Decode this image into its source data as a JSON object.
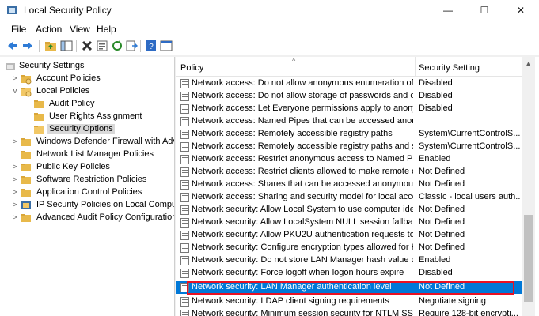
{
  "window": {
    "title": "Local Security Policy",
    "minimize_glyph": "—",
    "maximize_glyph": "☐",
    "close_glyph": "✕"
  },
  "menu": [
    "File",
    "Action",
    "View",
    "Help"
  ],
  "toolbar": {
    "icons": [
      "back-arrow-icon",
      "forward-arrow-icon",
      "up-folder-icon",
      "show-hide-tree-icon",
      "delete-icon",
      "properties-icon",
      "refresh-icon",
      "export-list-icon",
      "help-icon",
      "help-topics-icon"
    ]
  },
  "tree": [
    {
      "label": "Security Settings",
      "level": 0,
      "expanded": true,
      "icon": "security-settings-icon"
    },
    {
      "label": "Account Policies",
      "level": 1,
      "expander": "collapsed",
      "icon": "folder-icon"
    },
    {
      "label": "Local Policies",
      "level": 1,
      "expander": "expanded",
      "icon": "folder-open-icon"
    },
    {
      "label": "Audit Policy",
      "level": 2,
      "icon": "folder-icon"
    },
    {
      "label": "User Rights Assignment",
      "level": 2,
      "icon": "folder-icon"
    },
    {
      "label": "Security Options",
      "level": 2,
      "icon": "folder-open-icon",
      "selected": true
    },
    {
      "label": "Windows Defender Firewall with Adva",
      "level": 1,
      "expander": "collapsed",
      "icon": "folder-icon"
    },
    {
      "label": "Network List Manager Policies",
      "level": 1,
      "icon": "folder-icon"
    },
    {
      "label": "Public Key Policies",
      "level": 1,
      "expander": "collapsed",
      "icon": "folder-icon"
    },
    {
      "label": "Software Restriction Policies",
      "level": 1,
      "expander": "collapsed",
      "icon": "folder-icon"
    },
    {
      "label": "Application Control Policies",
      "level": 1,
      "expander": "collapsed",
      "icon": "folder-icon"
    },
    {
      "label": "IP Security Policies on Local Compute",
      "level": 1,
      "expander": "collapsed",
      "icon": "ip-security-icon"
    },
    {
      "label": "Advanced Audit Policy Configuration",
      "level": 1,
      "expander": "collapsed",
      "icon": "folder-icon"
    }
  ],
  "list": {
    "columns": {
      "policy": "Policy",
      "setting": "Security Setting"
    },
    "sort_caret": "^",
    "rows": [
      {
        "policy": "Network access: Do not allow anonymous enumeration of S...",
        "setting": "Disabled"
      },
      {
        "policy": "Network access: Do not allow storage of passwords and cre...",
        "setting": "Disabled"
      },
      {
        "policy": "Network access: Let Everyone permissions apply to anonym...",
        "setting": "Disabled"
      },
      {
        "policy": "Network access: Named Pipes that can be accessed anonym...",
        "setting": ""
      },
      {
        "policy": "Network access: Remotely accessible registry paths",
        "setting": "System\\CurrentControlS..."
      },
      {
        "policy": "Network access: Remotely accessible registry paths and sub...",
        "setting": "System\\CurrentControlS..."
      },
      {
        "policy": "Network access: Restrict anonymous access to Named Pipes...",
        "setting": "Enabled"
      },
      {
        "policy": "Network access: Restrict clients allowed to make remote call...",
        "setting": "Not Defined"
      },
      {
        "policy": "Network access: Shares that can be accessed anonymously",
        "setting": "Not Defined"
      },
      {
        "policy": "Network access: Sharing and security model for local accou...",
        "setting": "Classic - local users auth..."
      },
      {
        "policy": "Network security: Allow Local System to use computer ident...",
        "setting": "Not Defined"
      },
      {
        "policy": "Network security: Allow LocalSystem NULL session fallback",
        "setting": "Not Defined"
      },
      {
        "policy": "Network security: Allow PKU2U authentication requests to t...",
        "setting": "Not Defined"
      },
      {
        "policy": "Network security: Configure encryption types allowed for Ke...",
        "setting": "Not Defined"
      },
      {
        "policy": "Network security: Do not store LAN Manager hash value on ...",
        "setting": "Enabled"
      },
      {
        "policy": "Network security: Force logoff when logon hours expire",
        "setting": "Disabled"
      },
      {
        "policy": "Network security: LAN Manager authentication level",
        "setting": "Not Defined",
        "selected": true
      },
      {
        "policy": "Network security: LDAP client signing requirements",
        "setting": "Negotiate signing"
      },
      {
        "policy": "Network security: Minimum session security for NTLM SSP ...",
        "setting": "Require 128-bit encrypti..."
      }
    ]
  },
  "colors": {
    "selection": "#0078d7",
    "highlight_box": "#e81123",
    "folder": "#e8b94a"
  }
}
